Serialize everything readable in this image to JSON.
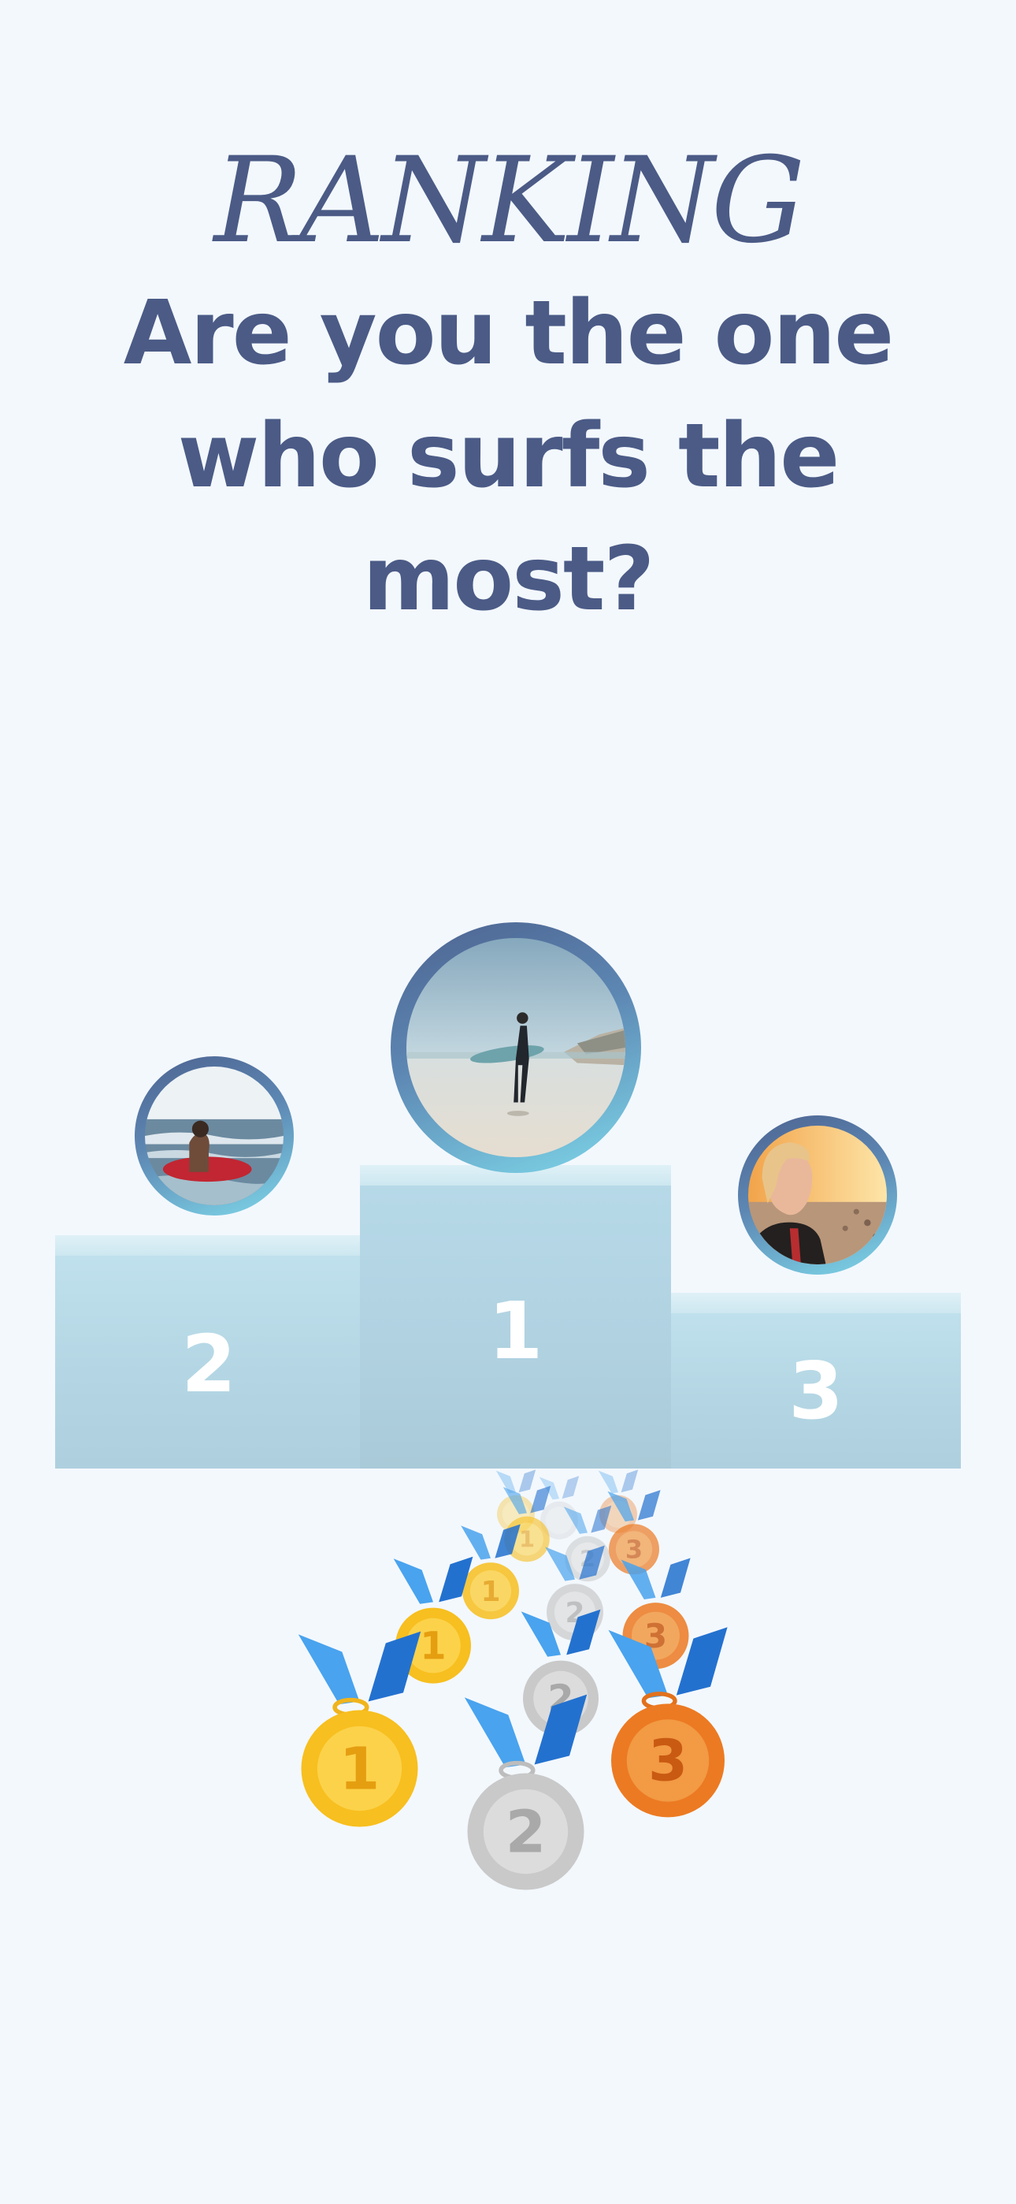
{
  "header": {
    "kicker": "RANKING",
    "headline": "Are you the one who surfs the most?"
  },
  "podium": [
    {
      "rank": "1",
      "photo": "surfer-standing-with-board-on-beach"
    },
    {
      "rank": "2",
      "photo": "surfer-with-red-board-in-water"
    },
    {
      "rank": "3",
      "photo": "surfer-in-wetsuit-at-sunset"
    }
  ],
  "medals": {
    "gold": "1",
    "silver": "2",
    "bronze": "3"
  },
  "colors": {
    "background": "#f3f8fd",
    "text": "#4b5b86",
    "podium": "#b6d9e8",
    "ribbon": "#2f86e0",
    "gold": "#f7bf1f",
    "silver": "#c9c9c9",
    "bronze": "#ec7a22"
  }
}
